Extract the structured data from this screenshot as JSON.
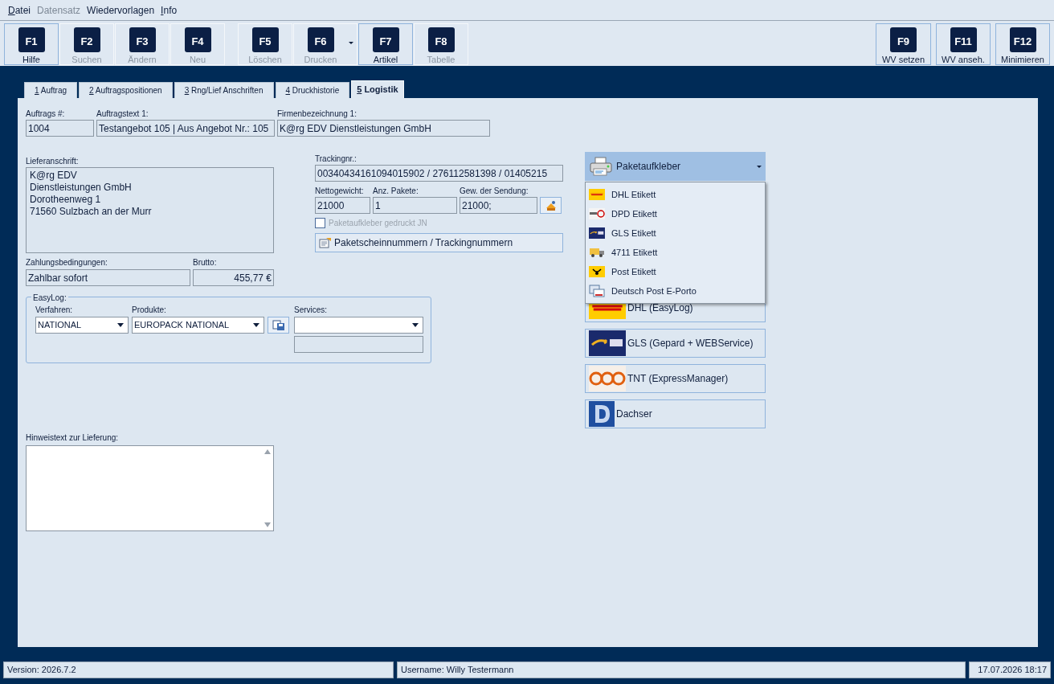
{
  "menu": [
    {
      "label": "Datei",
      "mnemonic": true,
      "disabled": false
    },
    {
      "label": "Datensatz",
      "mnemonic": false,
      "disabled": true
    },
    {
      "label": "Wiedervorlagen",
      "mnemonic": false,
      "disabled": false
    },
    {
      "label": "Info",
      "mnemonic": true,
      "disabled": false
    }
  ],
  "toolbar": {
    "groups": [
      [
        {
          "key": "F1",
          "label": "Hilfe",
          "disabled": false,
          "outlined": true,
          "dropdown": false
        },
        {
          "key": "F2",
          "label": "Suchen",
          "disabled": true,
          "outlined": false,
          "dropdown": false
        },
        {
          "key": "F3",
          "label": "Ändern",
          "disabled": true,
          "outlined": false,
          "dropdown": false
        },
        {
          "key": "F4",
          "label": "Neu",
          "disabled": true,
          "outlined": false,
          "dropdown": false
        }
      ],
      [
        {
          "key": "F5",
          "label": "Löschen",
          "disabled": true,
          "outlined": false,
          "dropdown": false
        },
        {
          "key": "F6",
          "label": "Drucken",
          "disabled": true,
          "outlined": false,
          "dropdown": true
        },
        {
          "key": "F7",
          "label": "Artikel",
          "disabled": false,
          "outlined": true,
          "dropdown": false
        },
        {
          "key": "F8",
          "label": "Tabelle",
          "disabled": true,
          "outlined": false,
          "dropdown": false
        }
      ],
      [
        {
          "key": "F9",
          "label": "WV setzen",
          "disabled": false,
          "outlined": true,
          "dropdown": false
        },
        {
          "key": "F11",
          "label": "WV anseh.",
          "disabled": false,
          "outlined": true,
          "dropdown": false
        },
        {
          "key": "F12",
          "label": "Minimieren",
          "disabled": false,
          "outlined": true,
          "dropdown": false
        }
      ]
    ]
  },
  "tabs": [
    {
      "number": "1",
      "label": "Auftrag",
      "selected": false
    },
    {
      "number": "2",
      "label": "Auftragspositionen",
      "selected": false
    },
    {
      "number": "3",
      "label": "Rng/Lief Anschriften",
      "selected": false
    },
    {
      "number": "4",
      "label": "Druckhistorie",
      "selected": false
    },
    {
      "number": "5",
      "label": "Logistik",
      "selected": true
    }
  ],
  "header_fields": [
    {
      "label": "Auftrags #:",
      "value": "1004"
    },
    {
      "label": "Auftragstext 1:",
      "value": "Testangebot 105 | Aus Angebot Nr.: 105"
    },
    {
      "label": "Firmenbezeichnung 1:",
      "value": "K@rg EDV Dienstleistungen GmbH"
    }
  ],
  "delivery_address": {
    "label": "Lieferanschrift:",
    "lines": [
      "K@rg EDV",
      "Dienstleistungen GmbH",
      "Dorotheenweg 1",
      "71560 Sulzbach an der Murr"
    ]
  },
  "payment": {
    "label": "Zahlungsbedingungen:",
    "value": "Zahlbar sofort"
  },
  "gross": {
    "label": "Brutto:",
    "value": "455,77 €"
  },
  "easylog": {
    "title": "EasyLog:",
    "procedure": {
      "label": "Verfahren:",
      "value": "NATIONAL"
    },
    "products": {
      "label": "Produkte:",
      "value": "EUROPACK NATIONAL"
    },
    "services": {
      "label": "Services:"
    }
  },
  "note": {
    "label": "Hinweistext zur Lieferung:"
  },
  "tracking": {
    "label": "Trackingnr.:",
    "value": "00340434161094015902 / 276112581398 / 01405215"
  },
  "weights": [
    {
      "label": "Nettogewicht:",
      "value": "21000"
    },
    {
      "label": "Anz. Pakete:",
      "value": "1"
    },
    {
      "label": "Gew. der Sendung:",
      "value": "21000;"
    }
  ],
  "printed_checkbox": {
    "label": "Paketaufkleber gedruckt JN",
    "checked": false,
    "disabled": true
  },
  "tracking_button": {
    "label": "Paketscheinnummern / Trackingnummern"
  },
  "labels_menu": {
    "button": "Paketaufkleber",
    "expanded": true,
    "items": [
      {
        "label": "DHL Etikett",
        "kind": "dhl"
      },
      {
        "label": "DPD Etikett",
        "kind": "dpd"
      },
      {
        "label": "GLS Etikett",
        "kind": "gls"
      },
      {
        "label": "4711 Etikett",
        "kind": "truck"
      },
      {
        "label": "Post Etikett",
        "kind": "post"
      },
      {
        "label": "Deutsch Post E-Porto",
        "kind": "eporto"
      }
    ]
  },
  "carriers": [
    {
      "label": "DHL (EasyLog)",
      "kind": "dhl"
    },
    {
      "label": "GLS (Gepard + WEBService)",
      "kind": "gls"
    },
    {
      "label": "TNT (ExpressManager)",
      "kind": "tnt"
    },
    {
      "label": "Dachser",
      "kind": "dachser"
    }
  ],
  "status_bar": {
    "version": "Version: 2026.7.2",
    "user": "Username: Willy Testermann",
    "datetime": "17.07.2026 18:17"
  }
}
